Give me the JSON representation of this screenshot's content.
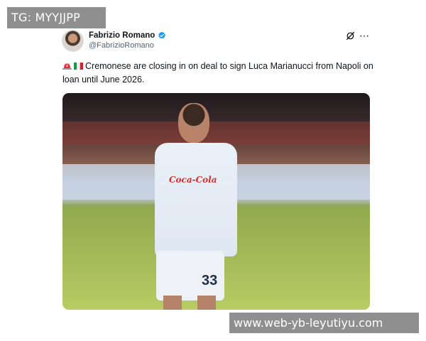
{
  "watermarks": {
    "top": "TG: MYYJJPP",
    "bottom": "www.web-yb-leyutiyu.com"
  },
  "tweet": {
    "author_name": "Fabrizio Romano",
    "author_handle": "@FabrizioRomano",
    "verified": true,
    "text": "Cremonese are closing in on deal to sign Luca Marianucci from Napoli on loan until June 2026.",
    "leading_emojis": [
      "siren-emoji",
      "italy-flag-emoji"
    ],
    "media": {
      "shirt_sponsor": "Coca-Cola",
      "shirt_number": "33"
    }
  },
  "icons": {
    "verified": "verified-badge-icon",
    "grok": "grok-icon",
    "more": "more-options-icon"
  },
  "colors": {
    "verified_blue": "#1d9bf0",
    "watermark_bg": "#8f8f8f"
  }
}
